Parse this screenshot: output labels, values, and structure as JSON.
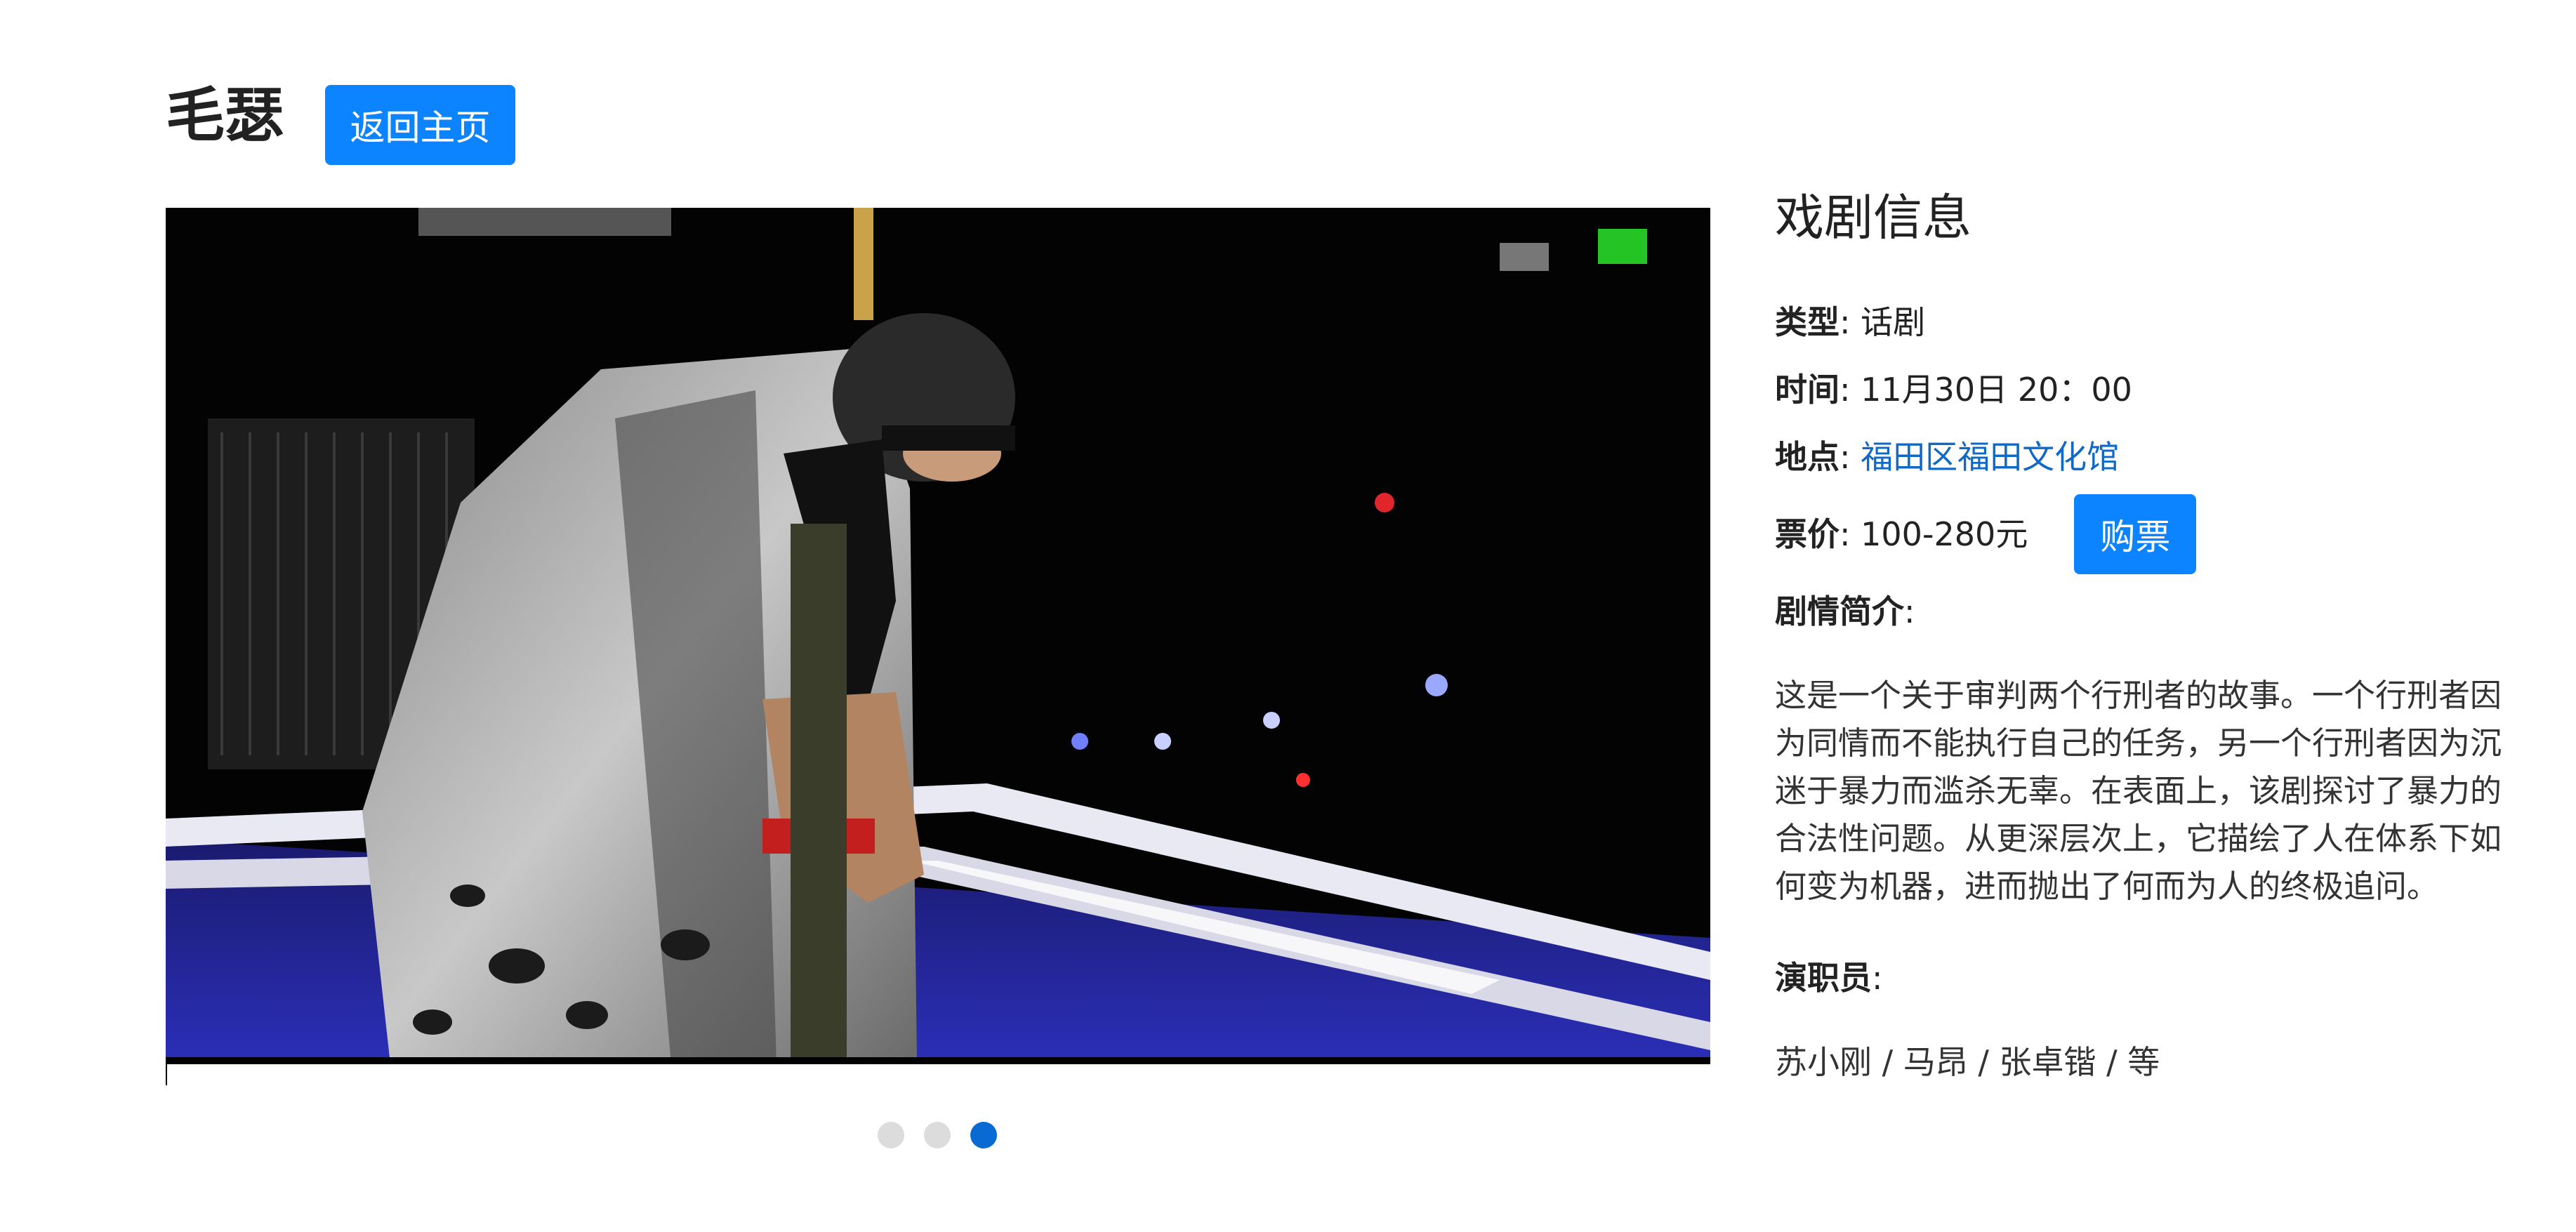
{
  "header": {
    "title": "毛瑟",
    "home_button_label": "返回主页"
  },
  "carousel": {
    "active_index": 2,
    "indicator_count": 3,
    "image_description_icon": "stage-photo"
  },
  "info": {
    "heading": "戏剧信息",
    "genre_label": "类型",
    "genre_value": "话剧",
    "time_label": "时间",
    "time_value": "11月30日 20：00",
    "venue_label": "地点",
    "venue_value": "福田区福田文化馆",
    "price_label": "票价",
    "price_value": "100-280元",
    "buy_button_label": "购票",
    "synopsis_label": "剧情简介",
    "synopsis_text": "这是一个关于审判两个行刑者的故事。一个行刑者因为同情而不能执行自己的任务，另一个行刑者因为沉迷于暴力而滥杀无辜。在表面上，该剧探讨了暴力的合法性问题。从更深层次上，它描绘了人在体系下如何变为机器，进而抛出了何而为人的终极追问。",
    "cast_label": "演职员",
    "cast_value": "苏小刚 / 马昂 / 张卓锴 / 等"
  },
  "colors": {
    "primary_button": "#0d84ff",
    "link": "#1069c6",
    "indicator_active": "#0a6ad3",
    "indicator_inactive": "#dcdcdc"
  }
}
